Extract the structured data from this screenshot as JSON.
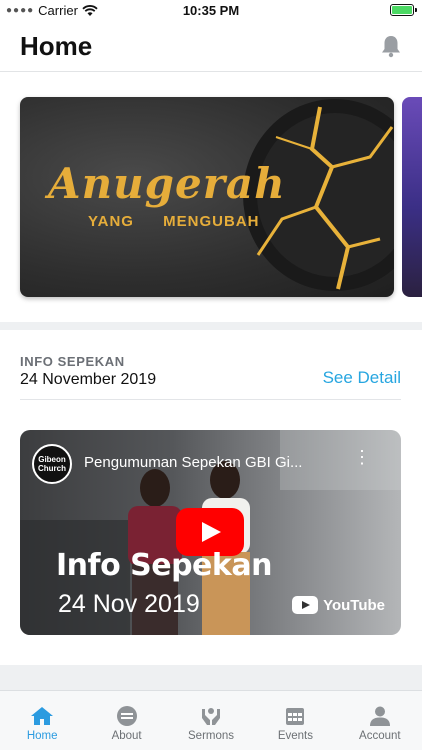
{
  "status_bar": {
    "carrier": "Carrier",
    "time": "10:35 PM"
  },
  "header": {
    "title": "Home"
  },
  "banner": {
    "script_text": "Anugerah",
    "subtitle": "YANG MENGUBAH"
  },
  "info": {
    "label": "INFO SEPEKAN",
    "date": "24 November 2019",
    "see_detail": "See Detail"
  },
  "video": {
    "channel_logo": "Gibeon Church",
    "title": "Pengumuman Sepekan GBI Gi...",
    "overlay_line1": "Info Sepekan",
    "overlay_line2": "24 Nov 2019",
    "youtube_label": "YouTube"
  },
  "tabs": [
    {
      "label": "Home",
      "icon": "home-icon",
      "active": true
    },
    {
      "label": "About",
      "icon": "church-logo-icon",
      "active": false
    },
    {
      "label": "Sermons",
      "icon": "hands-icon",
      "active": false
    },
    {
      "label": "Events",
      "icon": "calendar-icon",
      "active": false
    },
    {
      "label": "Account",
      "icon": "person-icon",
      "active": false
    }
  ],
  "colors": {
    "accent": "#2b9be0",
    "link": "#27a6e0",
    "banner_gold": "#e6ad3a",
    "youtube_red": "#ff0000"
  }
}
